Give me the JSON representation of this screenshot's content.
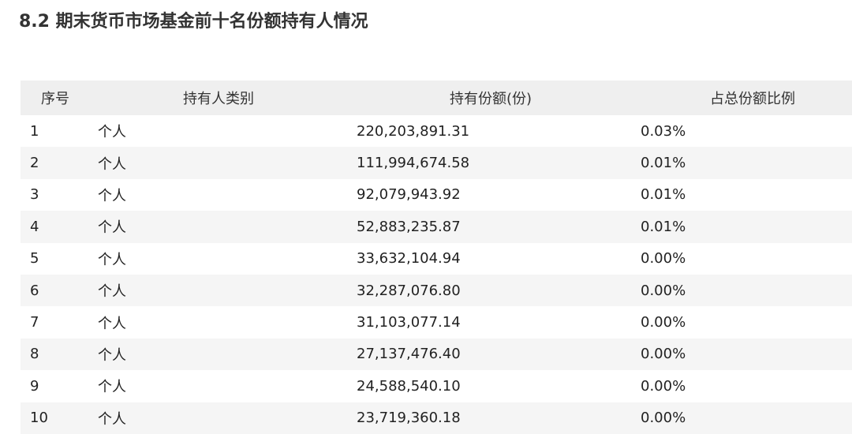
{
  "title": "8.2 期末货币市场基金前十名份额持有人情况",
  "table": {
    "headers": [
      "序号",
      "持有人类别",
      "持有份额(份)",
      "占总份额比例"
    ],
    "rows": [
      [
        "1",
        "个人",
        "220,203,891.31",
        "0.03%"
      ],
      [
        "2",
        "个人",
        "111,994,674.58",
        "0.01%"
      ],
      [
        "3",
        "个人",
        "92,079,943.92",
        "0.01%"
      ],
      [
        "4",
        "个人",
        "52,883,235.87",
        "0.01%"
      ],
      [
        "5",
        "个人",
        "33,632,104.94",
        "0.00%"
      ],
      [
        "6",
        "个人",
        "32,287,076.80",
        "0.00%"
      ],
      [
        "7",
        "个人",
        "31,103,077.14",
        "0.00%"
      ],
      [
        "8",
        "个人",
        "27,137,476.40",
        "0.00%"
      ],
      [
        "9",
        "个人",
        "24,588,540.10",
        "0.00%"
      ],
      [
        "10",
        "个人",
        "23,719,360.18",
        "0.00%"
      ]
    ]
  }
}
